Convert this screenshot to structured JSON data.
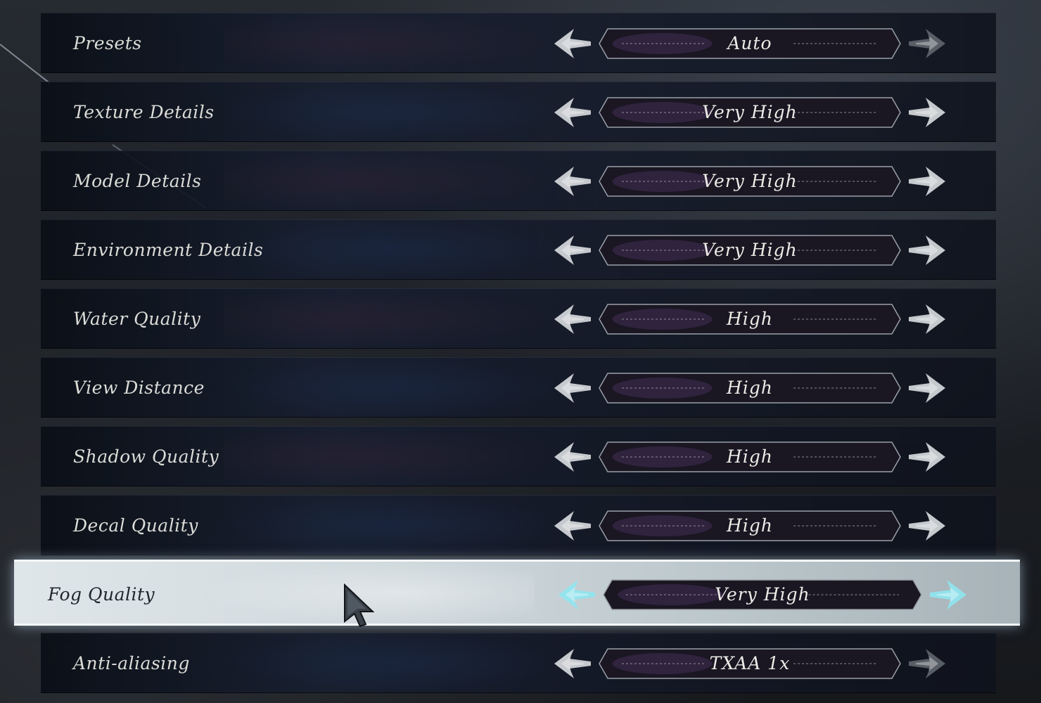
{
  "settings": [
    {
      "label": "Presets",
      "value": "Auto",
      "left_arrow_enabled": true,
      "right_arrow_enabled": false
    },
    {
      "label": "Texture Details",
      "value": "Very High",
      "left_arrow_enabled": true,
      "right_arrow_enabled": true
    },
    {
      "label": "Model Details",
      "value": "Very High",
      "left_arrow_enabled": true,
      "right_arrow_enabled": true
    },
    {
      "label": "Environment Details",
      "value": "Very High",
      "left_arrow_enabled": true,
      "right_arrow_enabled": true
    },
    {
      "label": "Water Quality",
      "value": "High",
      "left_arrow_enabled": true,
      "right_arrow_enabled": true
    },
    {
      "label": "View Distance",
      "value": "High",
      "left_arrow_enabled": true,
      "right_arrow_enabled": true
    },
    {
      "label": "Shadow Quality",
      "value": "High",
      "left_arrow_enabled": true,
      "right_arrow_enabled": true
    },
    {
      "label": "Decal Quality",
      "value": "High",
      "left_arrow_enabled": true,
      "right_arrow_enabled": true
    },
    {
      "label": "Fog Quality",
      "value": "Very High",
      "left_arrow_enabled": true,
      "right_arrow_enabled": true,
      "selected": true
    },
    {
      "label": "Anti-aliasing",
      "value": "TXAA 1x",
      "left_arrow_enabled": true,
      "right_arrow_enabled": false
    }
  ],
  "icons": {
    "left_arrow": "arrow-left-icon",
    "right_arrow": "arrow-right-icon",
    "cursor": "mouse-cursor-icon"
  },
  "colors": {
    "arrow_enabled": "#d9dde0",
    "arrow_disabled": "#5f666d",
    "arrow_selected": "#8ee6ef",
    "value_box_fill": "#1a1622",
    "value_box_glow": "#3b2a4a",
    "label_text": "#dcdcd8",
    "label_text_selected": "#20262e"
  }
}
